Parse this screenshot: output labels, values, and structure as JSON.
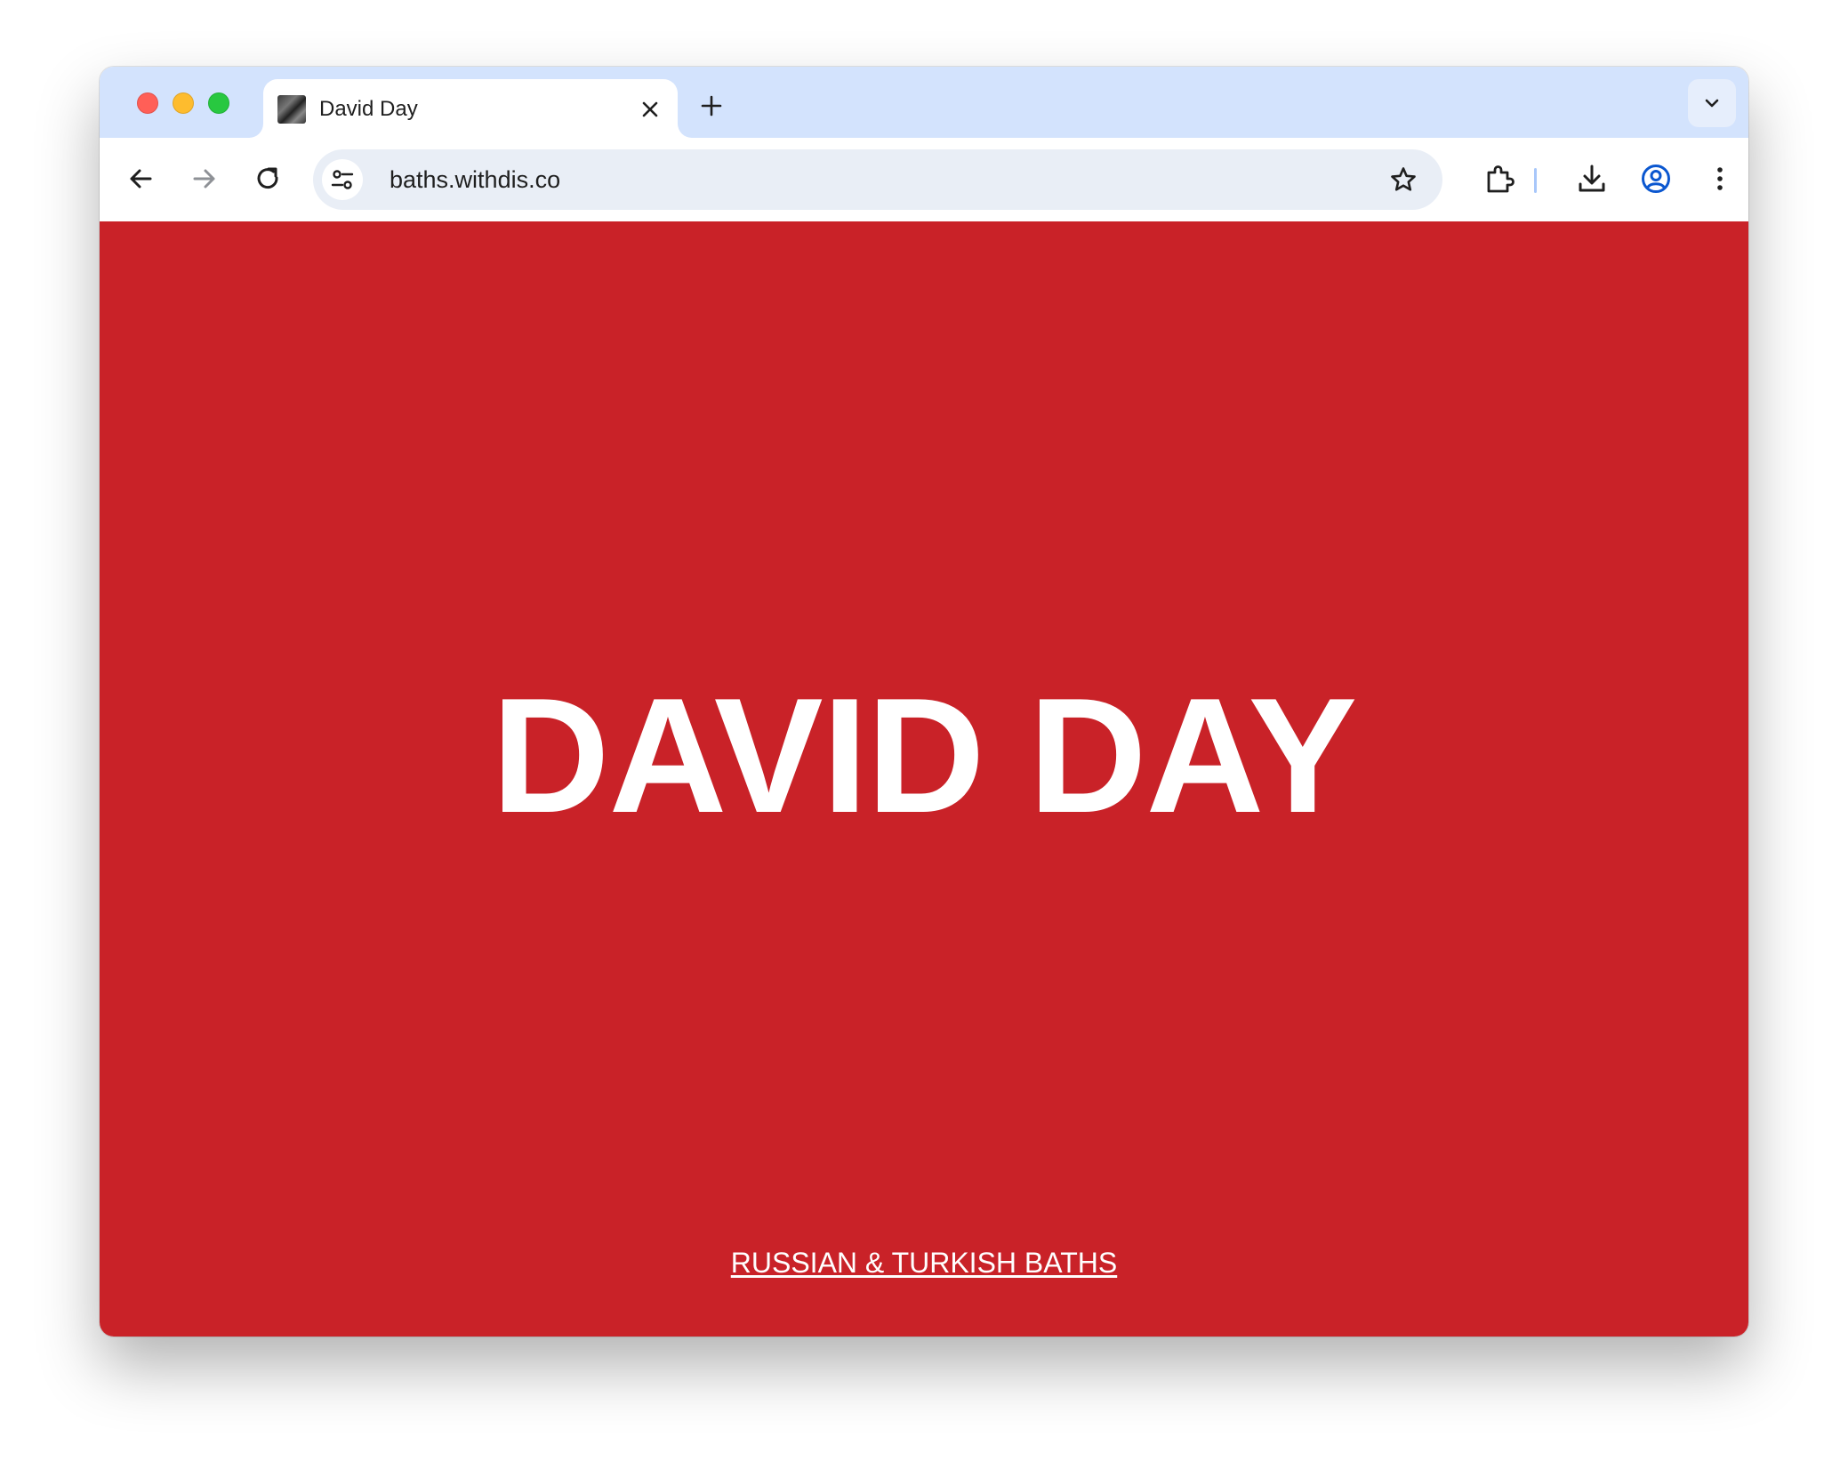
{
  "browser": {
    "tab": {
      "title": "David Day",
      "favicon": "site-thumbnail"
    },
    "address_bar": {
      "url": "baths.withdis.co"
    },
    "icons": {
      "back": "arrow-left-icon",
      "forward": "arrow-right-icon",
      "reload": "reload-icon",
      "site_info": "tune-icon",
      "bookmark": "star-icon",
      "extensions": "puzzle-icon",
      "downloads": "download-icon",
      "profile": "account-circle-icon",
      "menu": "more-vert-icon",
      "tab_close": "close-icon",
      "new_tab": "plus-icon",
      "tab_search": "chevron-down-icon"
    },
    "colors": {
      "tabstrip": "#d3e3fd",
      "omnibox": "#e9eef6",
      "accent": "#0b57d0"
    }
  },
  "page": {
    "heading": "DAVID DAY",
    "link_text": "RUSSIAN & TURKISH BATHS",
    "colors": {
      "background": "#c92228",
      "text": "#ffffff"
    }
  }
}
